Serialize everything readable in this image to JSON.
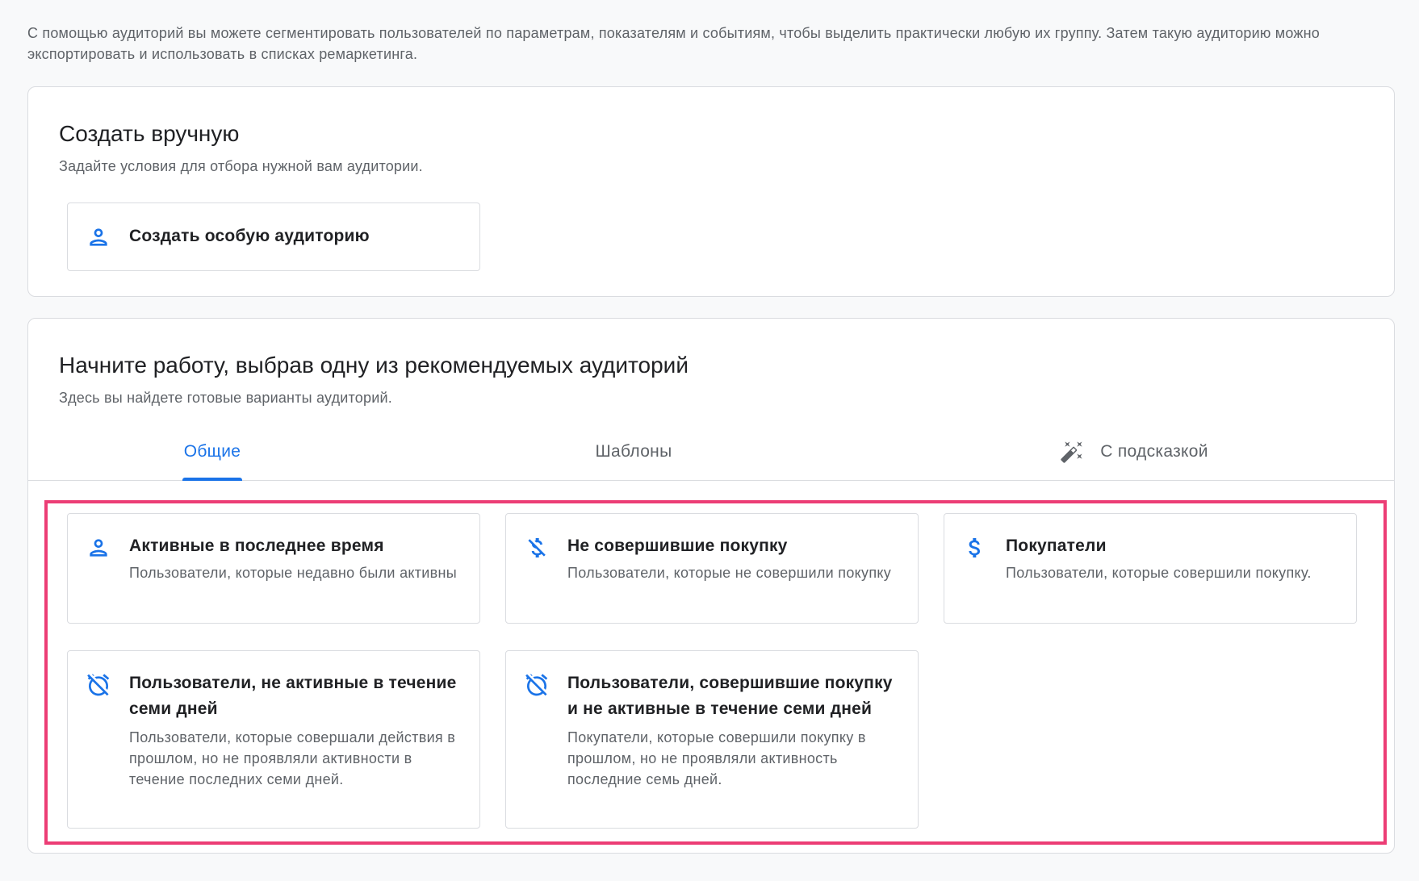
{
  "intro_text": "С помощью аудиторий вы можете сегментировать пользователей по параметрам, показателям и событиям, чтобы выделить практически любую их группу. Затем такую аудиторию можно экспортировать и использовать в списках ремаркетинга.",
  "manual": {
    "title": "Создать вручную",
    "subtitle": "Задайте условия для отбора нужной вам аудитории.",
    "create_button": {
      "label": "Создать особую аудиторию",
      "icon": "person-icon"
    }
  },
  "recommended": {
    "title": "Начните работу, выбрав одну из рекомендуемых аудиторий",
    "subtitle": "Здесь вы найдете готовые варианты аудиторий.",
    "tabs": [
      {
        "label": "Общие",
        "active": true
      },
      {
        "label": "Шаблоны",
        "active": false
      },
      {
        "label": "С подсказкой",
        "active": false,
        "icon": "magic-wand-icon"
      }
    ],
    "audiences": [
      {
        "icon": "person-icon",
        "title": "Активные в последнее время",
        "description": "Пользователи, которые недавно были активны"
      },
      {
        "icon": "money-off-icon",
        "title": "Не совершившие покупку",
        "description": "Пользователи, которые не совершили покупку"
      },
      {
        "icon": "dollar-icon",
        "title": "Покупатели",
        "description": "Пользователи, которые совершили покупку."
      },
      {
        "icon": "alarm-off-icon",
        "title": "Пользователи, не активные в течение семи дней",
        "description": "Пользователи, которые совершали действия в прошлом, но не проявляли активности в течение последних семи дней."
      },
      {
        "icon": "alarm-off-icon",
        "title": "Пользователи, совершившие покупку и не активные в течение семи дней",
        "description": "Покупатели, которые совершили покупку в прошлом, но не проявляли активность последние семь дней."
      }
    ]
  },
  "colors": {
    "accent": "#1a73e8",
    "highlight": "#ec3d75",
    "background": "#f8f9fa",
    "text_primary": "#202124",
    "text_secondary": "#5f6368",
    "border": "#dadce0"
  }
}
